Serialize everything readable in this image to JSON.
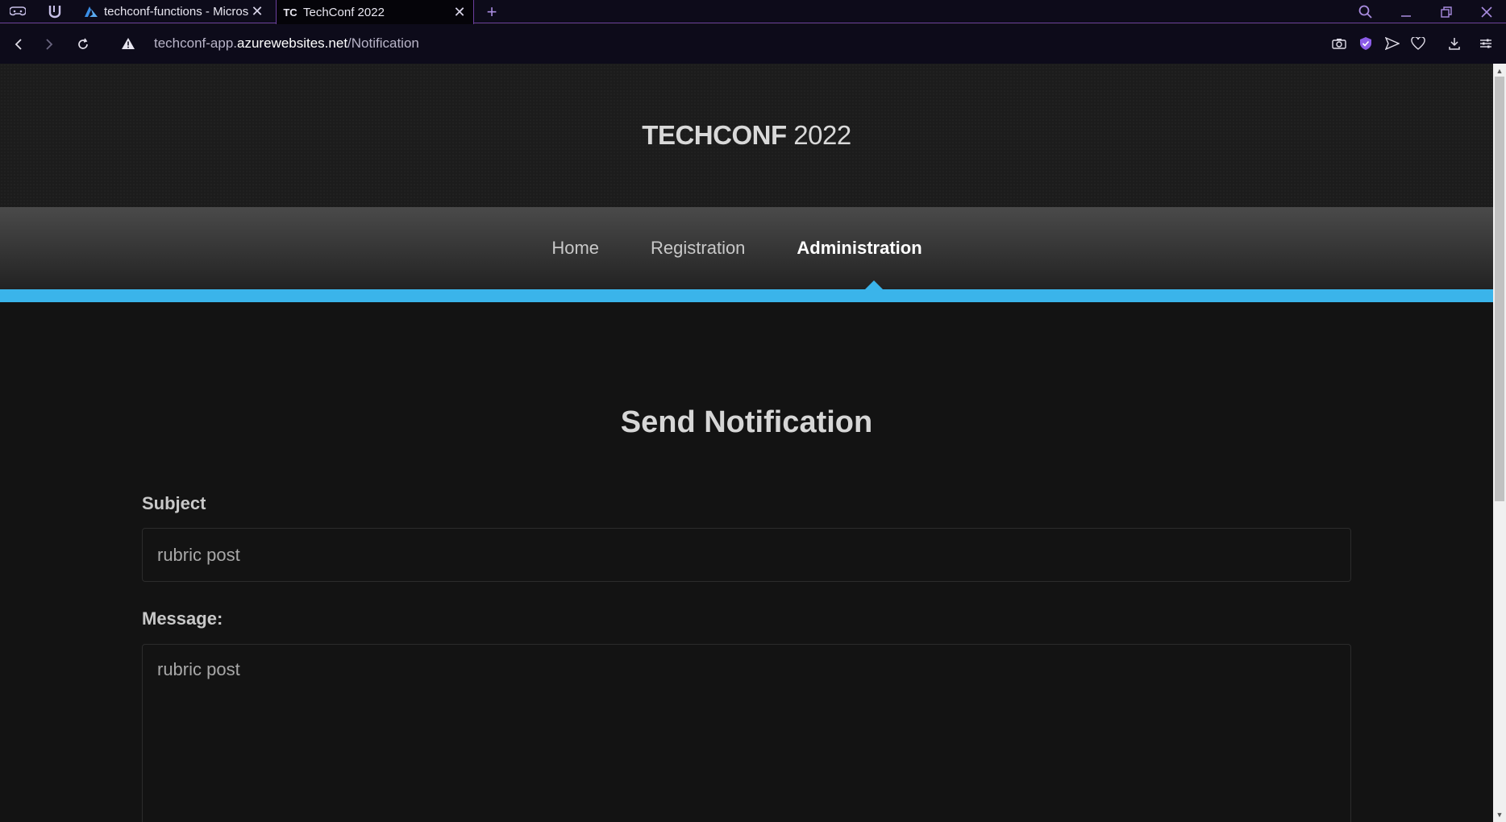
{
  "browser": {
    "tabs": [
      {
        "title": "techconf-functions - Micros",
        "favicon": "azure-icon",
        "active": false
      },
      {
        "title": "TechConf 2022",
        "favicon_text": "TC",
        "active": true
      }
    ],
    "address": {
      "prefix": "techconf-app.",
      "host": "azurewebsites.net",
      "path": "/Notification"
    }
  },
  "site": {
    "brand_bold": "TECHCONF",
    "brand_year": "2022",
    "nav": [
      {
        "label": "Home",
        "active": false
      },
      {
        "label": "Registration",
        "active": false
      },
      {
        "label": "Administration",
        "active": true
      }
    ],
    "accent_color": "#3ab4ea"
  },
  "form": {
    "heading": "Send Notification",
    "subject_label": "Subject",
    "subject_value": "rubric post",
    "message_label": "Message:",
    "message_value": "rubric post"
  }
}
